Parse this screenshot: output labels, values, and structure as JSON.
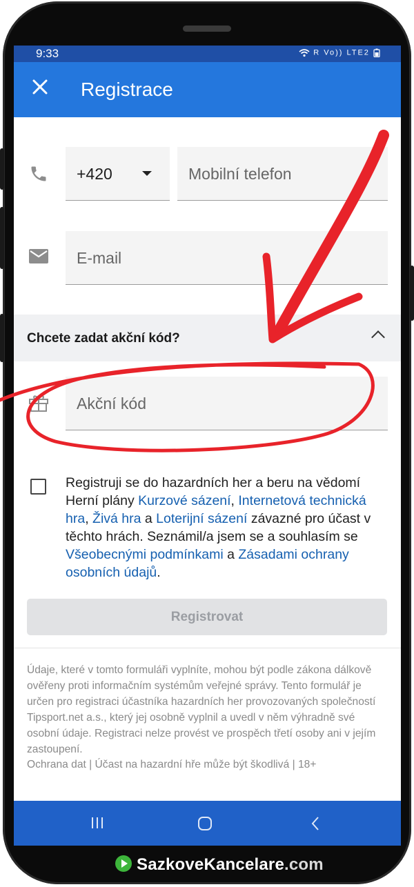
{
  "status": {
    "time": "9:33",
    "icons": "R  Vo)) LTE2"
  },
  "appbar": {
    "title": "Registrace",
    "close_icon": "close-icon"
  },
  "form": {
    "country_code": "+420",
    "phone_placeholder": "Mobilní telefon",
    "email_placeholder": "E-mail",
    "promo_question": "Chcete zadat akční kód?",
    "promo_placeholder": "Akční kód"
  },
  "consent": {
    "t1": "Registruji se do hazardních her a beru na vědomí Herní plány ",
    "l1": "Kurzové sázení",
    "t2": ", ",
    "l2": "Internetová technická hra",
    "t3": ", ",
    "l3": "Živá hra",
    "t4": " a ",
    "l4": "Loterijní sázení",
    "t5": " závazné pro účast v těchto hrách. Seznámil/a jsem se a souhlasím se ",
    "l5": "Všeobecnými podmínkami",
    "t6": " a ",
    "l6": "Zásadami ochrany osobních údajů",
    "t7": "."
  },
  "register_button": "Registrovat",
  "legal_text": "Údaje, které v tomto formuláři vyplníte, mohou být podle zákona dálkově ověřeny proti informačním systémům veřejné správy. Tento formulář je určen pro registraci účastníka hazardních her provozovaných společností Tipsport.net a.s., který jej osobně vyplnil a uvedl v něm výhradně své osobní údaje. Registraci nelze provést ve prospěch třetí osoby ani v jejím zastoupení.",
  "footer": {
    "data_protection": "Ochrana dat",
    "sep": " | ",
    "gambling_warning": "Účast na hazardní hře může být škodlivá",
    "age": "18+"
  },
  "brand": {
    "name": "SazkoveKancelare",
    "tld": ".com"
  },
  "colors": {
    "appbar": "#2477dd",
    "link": "#1660b0",
    "annotation": "#e8232a"
  }
}
